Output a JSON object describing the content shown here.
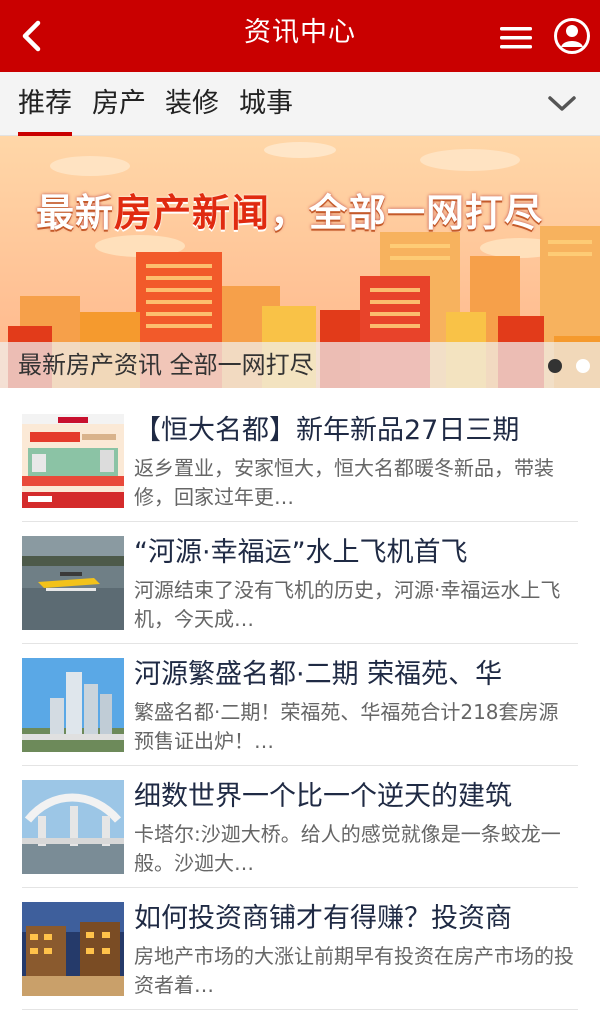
{
  "header": {
    "title": "资讯中心",
    "back_icon": "chevron-left-icon",
    "menu_icon": "hamburger-menu-icon",
    "user_icon": "user-icon",
    "brand_color": "#c90000"
  },
  "tabs": [
    {
      "label": "推荐",
      "active": true
    },
    {
      "label": "房产",
      "active": false
    },
    {
      "label": "装修",
      "active": false
    },
    {
      "label": "城事",
      "active": false
    }
  ],
  "expand_icon": "chevron-down-icon",
  "banner": {
    "headline_part1": "最新",
    "headline_part2": "房产新闻",
    "headline_part3": "，全部一网打尽",
    "caption": "最新房产资讯 全部一网打尽",
    "slides": 2,
    "active_slide": 0
  },
  "news": [
    {
      "title": "【恒大名都】新年新品27日三期",
      "summary": "返乡置业，安家恒大，恒大名都暖冬新品，带装修，回家过年更…",
      "thumb": "poster"
    },
    {
      "title": "“河源·幸福运”水上飞机首飞",
      "summary": "河源结束了没有飞机的历史，河源·幸福运水上飞机，今天成…",
      "thumb": "seaplane"
    },
    {
      "title": "河源繁盛名都·二期 荣福苑、华",
      "summary": "繁盛名都·二期！荣福苑、华福苑合计218套房源预售证出炉！…",
      "thumb": "towers"
    },
    {
      "title": "细数世界一个比一个逆天的建筑",
      "summary": "卡塔尔:沙迦大桥。给人的感觉就像是一条蛟龙一般。沙迦大…",
      "thumb": "bridge"
    },
    {
      "title": "如何投资商铺才有得赚？投资商",
      "summary": "房地产市场的大涨让前期早有投资在房产市场的投资者着…",
      "thumb": "street"
    }
  ]
}
